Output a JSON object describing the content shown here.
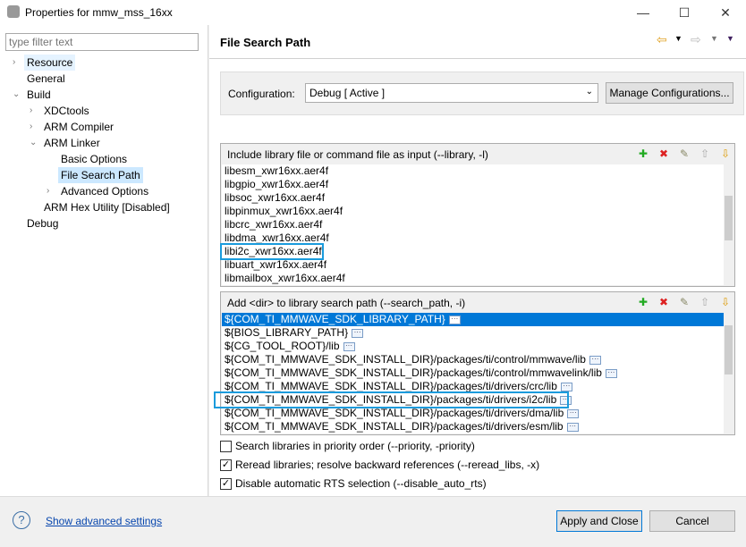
{
  "window": {
    "title": "Properties for mmw_mss_16xx",
    "minimize": "—",
    "maximize": "☐",
    "close": "✕"
  },
  "sidebar": {
    "filter_placeholder": "type filter text",
    "items": [
      {
        "label": "Resource",
        "level": 0,
        "twisty": "›"
      },
      {
        "label": "General",
        "level": 0,
        "twisty": ""
      },
      {
        "label": "Build",
        "level": 0,
        "twisty": "⌄"
      },
      {
        "label": "XDCtools",
        "level": 1,
        "twisty": "›"
      },
      {
        "label": "ARM Compiler",
        "level": 1,
        "twisty": "›"
      },
      {
        "label": "ARM Linker",
        "level": 1,
        "twisty": "⌄"
      },
      {
        "label": "Basic Options",
        "level": 2,
        "twisty": ""
      },
      {
        "label": "File Search Path",
        "level": 2,
        "twisty": "",
        "selected": true
      },
      {
        "label": "Advanced Options",
        "level": 2,
        "twisty": "›"
      },
      {
        "label": "ARM Hex Utility  [Disabled]",
        "level": 1,
        "twisty": ""
      },
      {
        "label": "Debug",
        "level": 0,
        "twisty": ""
      }
    ]
  },
  "main": {
    "title": "File Search Path",
    "configuration": {
      "label": "Configuration:",
      "value": "Debug  [ Active ]",
      "manage_button": "Manage Configurations..."
    },
    "library_panel": {
      "header": "Include library file or command file as input (--library, -l)",
      "items": [
        "libesm_xwr16xx.aer4f",
        "libgpio_xwr16xx.aer4f",
        "libsoc_xwr16xx.aer4f",
        "libpinmux_xwr16xx.aer4f",
        "libcrc_xwr16xx.aer4f",
        "libdma_xwr16xx.aer4f",
        "libi2c_xwr16xx.aer4f",
        "libuart_xwr16xx.aer4f",
        "libmailbox_xwr16xx.aer4f"
      ],
      "highlighted": "libi2c_xwr16xx.aer4f"
    },
    "search_panel": {
      "header": "Add <dir> to library search path (--search_path, -i)",
      "items": [
        "${COM_TI_MMWAVE_SDK_LIBRARY_PATH}",
        "${BIOS_LIBRARY_PATH}",
        "${CG_TOOL_ROOT}/lib",
        "${COM_TI_MMWAVE_SDK_INSTALL_DIR}/packages/ti/control/mmwave/lib",
        "${COM_TI_MMWAVE_SDK_INSTALL_DIR}/packages/ti/control/mmwavelink/lib",
        "${COM_TI_MMWAVE_SDK_INSTALL_DIR}/packages/ti/drivers/crc/lib",
        "${COM_TI_MMWAVE_SDK_INSTALL_DIR}/packages/ti/drivers/i2c/lib",
        "${COM_TI_MMWAVE_SDK_INSTALL_DIR}/packages/ti/drivers/dma/lib",
        "${COM_TI_MMWAVE_SDK_INSTALL_DIR}/packages/ti/drivers/esm/lib"
      ],
      "selected": "${COM_TI_MMWAVE_SDK_LIBRARY_PATH}",
      "highlighted": "${COM_TI_MMWAVE_SDK_INSTALL_DIR}/packages/ti/drivers/i2c/lib"
    },
    "options": [
      {
        "label": "Search libraries in priority order (--priority, -priority)",
        "checked": false
      },
      {
        "label": "Reread libraries; resolve backward references (--reread_libs, -x)",
        "checked": true
      },
      {
        "label": "Disable automatic RTS selection (--disable_auto_rts)",
        "checked": true
      }
    ]
  },
  "footer": {
    "help": "?",
    "advanced_link": "Show advanced settings",
    "apply_close": "Apply and Close",
    "cancel": "Cancel"
  },
  "colors": {
    "selection": "#0078d7",
    "highlight_box": "#1a9bdc",
    "tree_selection": "#cce8ff"
  }
}
